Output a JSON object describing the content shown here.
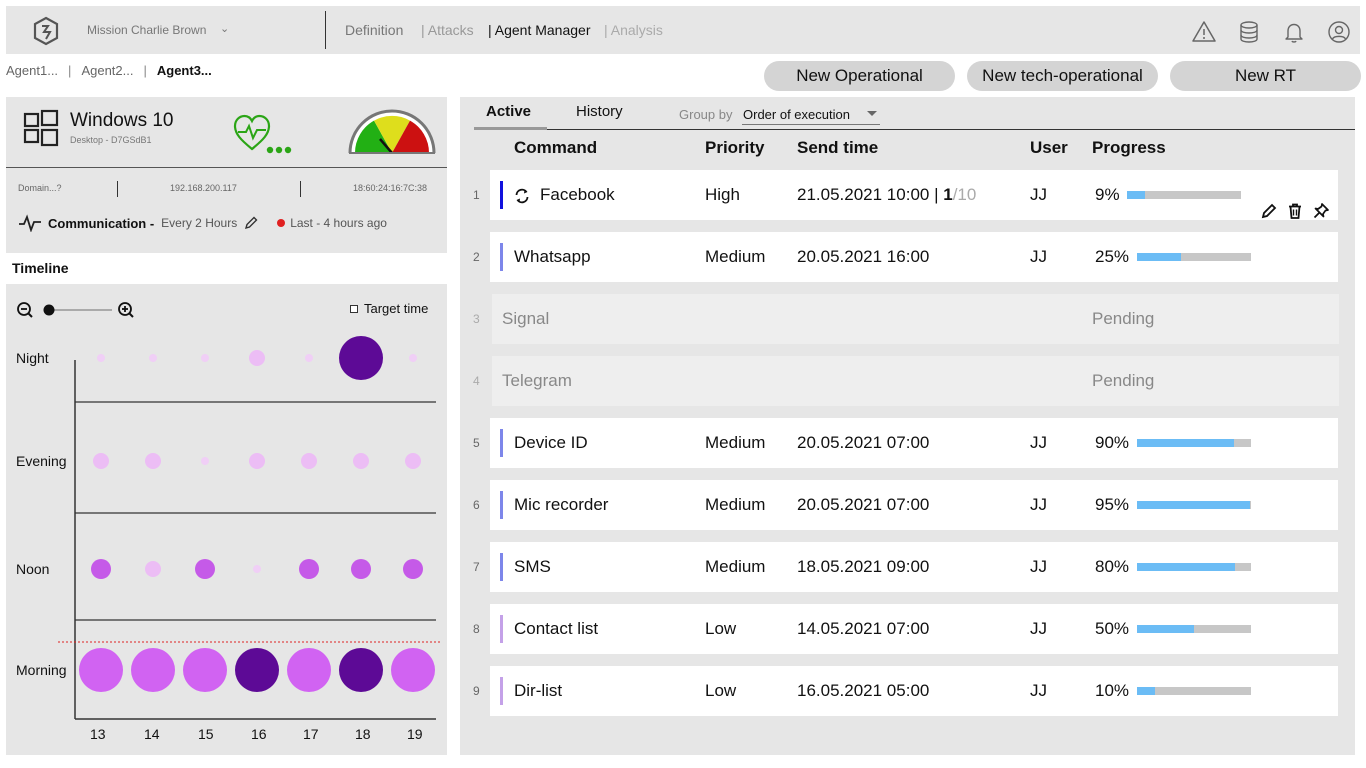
{
  "topbar": {
    "mission": "Mission Charlie Brown",
    "nav": [
      "Definition",
      "| Attacks",
      "| Agent Manager",
      "| Analysis"
    ]
  },
  "breadcrumbs": [
    "Agent1...",
    "Agent2...",
    "Agent3..."
  ],
  "actions": [
    "New Operational",
    "New tech-operational",
    "New RT"
  ],
  "agent": {
    "os": "Windows 10",
    "device": "Desktop - D7GSdB1",
    "domain": "Domain...?",
    "ip": "192.168.200.117",
    "mac": "18:60:24:16:7C:38",
    "communication_label": "Communication -",
    "communication_every": "Every 2 Hours",
    "last": "Last - 4 hours ago",
    "gauge_colors": [
      "#22b014",
      "#dede1c",
      "#cc1111"
    ],
    "health_color": "#2ba516"
  },
  "timeline": {
    "title": "Timeline",
    "target_time": "Target time",
    "rows": [
      "Night",
      "Evening",
      "Noon",
      "Morning"
    ],
    "days": [
      "13",
      "14",
      "15",
      "16",
      "17",
      "18",
      "19"
    ],
    "bubbles": {
      "Night": [
        {
          "r": 4,
          "c": "#f0cff6"
        },
        {
          "r": 4,
          "c": "#f0cff6"
        },
        {
          "r": 4,
          "c": "#f0cff6"
        },
        {
          "r": 8,
          "c": "#ecbdf5"
        },
        {
          "r": 4,
          "c": "#f0cff6"
        },
        {
          "r": 22,
          "c": "#5d0a96"
        },
        {
          "r": 4,
          "c": "#f0cff6"
        }
      ],
      "Evening": [
        {
          "r": 8,
          "c": "#ecbdf5"
        },
        {
          "r": 8,
          "c": "#ecbdf5"
        },
        {
          "r": 4,
          "c": "#f0cff6"
        },
        {
          "r": 8,
          "c": "#ecbdf5"
        },
        {
          "r": 8,
          "c": "#ecbdf5"
        },
        {
          "r": 8,
          "c": "#ecbdf5"
        },
        {
          "r": 8,
          "c": "#ecbdf5"
        }
      ],
      "Noon": [
        {
          "r": 10,
          "c": "#c55ae8"
        },
        {
          "r": 8,
          "c": "#ecbdf5"
        },
        {
          "r": 10,
          "c": "#c55ae8"
        },
        {
          "r": 4,
          "c": "#f0cff6"
        },
        {
          "r": 10,
          "c": "#c55ae8"
        },
        {
          "r": 10,
          "c": "#c55ae8"
        },
        {
          "r": 10,
          "c": "#c55ae8"
        }
      ],
      "Morning": [
        {
          "r": 22,
          "c": "#d163f2"
        },
        {
          "r": 22,
          "c": "#d163f2"
        },
        {
          "r": 22,
          "c": "#d163f2"
        },
        {
          "r": 22,
          "c": "#5d0a96"
        },
        {
          "r": 22,
          "c": "#d163f2"
        },
        {
          "r": 22,
          "c": "#5d0a96"
        },
        {
          "r": 22,
          "c": "#d163f2"
        }
      ]
    }
  },
  "tabs": [
    "Active",
    "History"
  ],
  "group_by": {
    "label": "Group by",
    "value": "Order of execution"
  },
  "columns": [
    "Command",
    "Priority",
    "Send time",
    "User",
    "Progress"
  ],
  "commands": [
    {
      "n": "1",
      "cmd": "Facebook",
      "priority": "High",
      "time": "21.05.2021 10:00 |",
      "iter_done": "1",
      "iter_total": "/10",
      "user": "JJ",
      "pct": "9%",
      "progress": 0.16,
      "accent": "#1111dd",
      "pending": false,
      "repeat": true
    },
    {
      "n": "2",
      "cmd": "Whatsapp",
      "priority": "Medium",
      "time": "20.05.2021 16:00",
      "user": "JJ",
      "pct": "25%",
      "progress": 0.39,
      "accent": "#7d86ea",
      "pending": false
    },
    {
      "n": "3",
      "cmd": "Signal",
      "status": "Pending",
      "pending": true
    },
    {
      "n": "4",
      "cmd": "Telegram",
      "status": "Pending",
      "pending": true
    },
    {
      "n": "5",
      "cmd": "Device ID",
      "priority": "Medium",
      "time": "20.05.2021 07:00",
      "user": "JJ",
      "pct": "90%",
      "progress": 0.85,
      "accent": "#7d86ea",
      "pending": false
    },
    {
      "n": "6",
      "cmd": "Mic recorder",
      "priority": "Medium",
      "time": "20.05.2021 07:00",
      "user": "JJ",
      "pct": "95%",
      "progress": 0.99,
      "accent": "#7d86ea",
      "pending": false
    },
    {
      "n": "7",
      "cmd": "SMS",
      "priority": "Medium",
      "time": "18.05.2021 09:00",
      "user": "JJ",
      "pct": "80%",
      "progress": 0.86,
      "accent": "#7d86ea",
      "pending": false
    },
    {
      "n": "8",
      "cmd": "Contact list",
      "priority": "Low",
      "time": "14.05.2021 07:00",
      "user": "JJ",
      "pct": "50%",
      "progress": 0.5,
      "accent": "#c4a1e8",
      "pending": false
    },
    {
      "n": "9",
      "cmd": "Dir-list",
      "priority": "Low",
      "time": "16.05.2021 05:00",
      "user": "JJ",
      "pct": "10%",
      "progress": 0.16,
      "accent": "#c4a1e8",
      "pending": false
    }
  ]
}
